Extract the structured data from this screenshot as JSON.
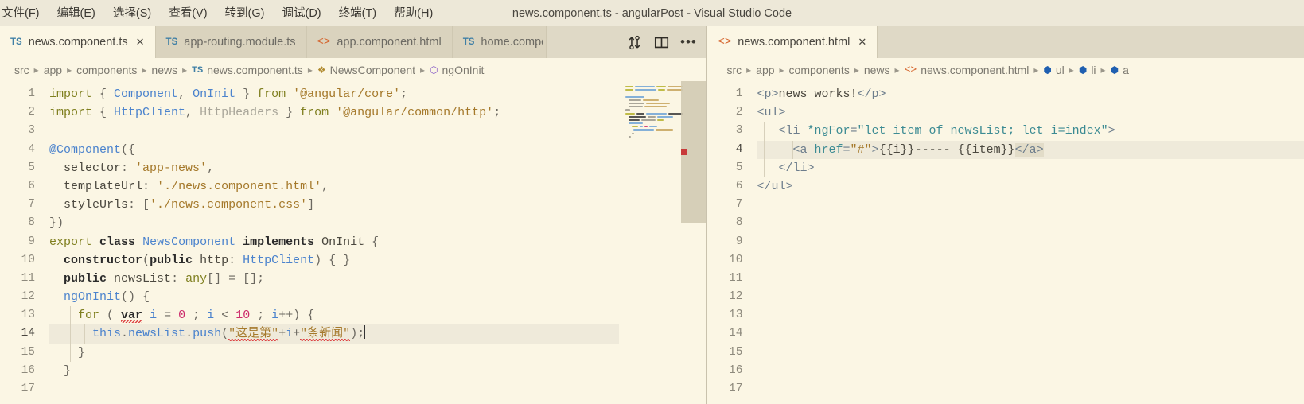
{
  "window": {
    "title": "news.component.ts - angularPost - Visual Studio Code"
  },
  "menubar": {
    "items": [
      {
        "label": "文件(F)",
        "name": "menu-file"
      },
      {
        "label": "编辑(E)",
        "name": "menu-edit"
      },
      {
        "label": "选择(S)",
        "name": "menu-selection"
      },
      {
        "label": "查看(V)",
        "name": "menu-view"
      },
      {
        "label": "转到(G)",
        "name": "menu-go"
      },
      {
        "label": "调试(D)",
        "name": "menu-debug"
      },
      {
        "label": "终端(T)",
        "name": "menu-terminal"
      },
      {
        "label": "帮助(H)",
        "name": "menu-help"
      }
    ]
  },
  "editor_groups": {
    "left": {
      "tabs": [
        {
          "label": "news.component.ts",
          "icon": "TS",
          "icon_kind": "ts",
          "active": true,
          "closable": true
        },
        {
          "label": "app-routing.module.ts",
          "icon": "TS",
          "icon_kind": "ts",
          "active": false,
          "closable": false
        },
        {
          "label": "app.component.html",
          "icon": "<>",
          "icon_kind": "html",
          "active": false,
          "closable": false
        },
        {
          "label": "home.compo",
          "icon": "TS",
          "icon_kind": "ts",
          "active": false,
          "closable": false
        }
      ],
      "actions": [
        {
          "name": "compare-changes-icon",
          "glyph": "⇅"
        },
        {
          "name": "split-editor-icon",
          "glyph": "▥"
        },
        {
          "name": "more-actions-icon",
          "glyph": "•••"
        }
      ],
      "breadcrumb": [
        {
          "label": "src",
          "icon": ""
        },
        {
          "label": "app",
          "icon": ""
        },
        {
          "label": "components",
          "icon": ""
        },
        {
          "label": "news",
          "icon": ""
        },
        {
          "label": "news.component.ts",
          "icon": "TS"
        },
        {
          "label": "NewsComponent",
          "icon": "class"
        },
        {
          "label": "ngOnInit",
          "icon": "method"
        }
      ],
      "close_label": "✕",
      "line_numbers": [
        "1",
        "2",
        "3",
        "4",
        "5",
        "6",
        "7",
        "8",
        "9",
        "10",
        "11",
        "12",
        "13",
        "14",
        "15",
        "16",
        "17"
      ],
      "current_line": 14
    },
    "right": {
      "tabs": [
        {
          "label": "news.component.html",
          "icon": "<>",
          "icon_kind": "html",
          "active": true,
          "closable": true
        }
      ],
      "breadcrumb": [
        {
          "label": "src",
          "icon": ""
        },
        {
          "label": "app",
          "icon": ""
        },
        {
          "label": "components",
          "icon": ""
        },
        {
          "label": "news",
          "icon": ""
        },
        {
          "label": "news.component.html",
          "icon": "<>"
        },
        {
          "label": "ul",
          "icon": "tag"
        },
        {
          "label": "li",
          "icon": "tag"
        },
        {
          "label": "a",
          "icon": "tag"
        }
      ],
      "close_label": "✕",
      "line_numbers": [
        "1",
        "2",
        "3",
        "4",
        "5",
        "6",
        "7",
        "8",
        "9",
        "10",
        "11",
        "12",
        "13",
        "14",
        "15",
        "16",
        "17"
      ],
      "current_line": 4
    }
  },
  "code_left": [
    "import { Component, OnInit } from '@angular/core';",
    "import { HttpClient, HttpHeaders } from '@angular/common/http';",
    "",
    "@Component({",
    "  selector: 'app-news',",
    "  templateUrl: './news.component.html',",
    "  styleUrls: ['./news.component.css']",
    "})",
    "export class NewsComponent implements OnInit {",
    "  constructor(public http: HttpClient) { }",
    "  public newsList: any[] = [];",
    "  ngOnInit() {",
    "    for ( var i = 0 ; i < 10 ; i++) {",
    "      this.newsList.push(\"这是第\"+i+\"条新闻\");",
    "    }",
    "  }",
    ""
  ],
  "code_right": [
    "<p>news works!</p>",
    "<ul>",
    "   <li *ngFor=\"let item of newsList; let i=index\">",
    "     <a href=\"#\">{{i}}----- {{item}}</a>",
    "   </li>",
    "</ul>",
    "",
    "",
    "",
    "",
    "",
    "",
    "",
    "",
    "",
    "",
    ""
  ],
  "colors": {
    "titlebar_bg": "#EDE8D8",
    "tab_inactive_bg": "#DAD3BE",
    "tab_active_bg": "#FBF6E4",
    "editor_bg": "#FBF6E4",
    "current_line_bg": "#EFEADA",
    "ts_icon": "#3f7fa5",
    "html_icon": "#d4622a",
    "keyword": "#7f7f1f",
    "type": "#4b83cd",
    "string": "#a5792b",
    "number": "#cc2a6b",
    "tag": "#6d7d8c",
    "attribute": "#3c8b93",
    "unused": "#a9a69a"
  }
}
